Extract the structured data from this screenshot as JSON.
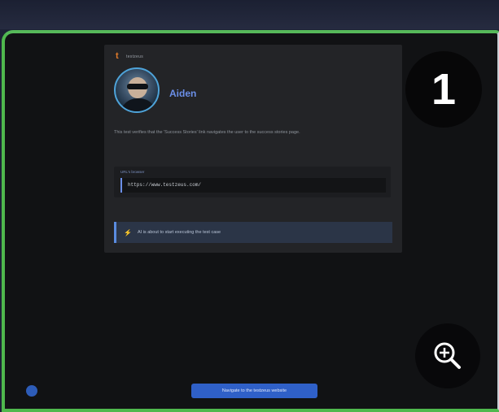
{
  "brand": {
    "logo_icon": "testzeus-logo-icon",
    "name": "testzeus",
    "logo_color": "#e07a2a"
  },
  "agent": {
    "name": "Aiden",
    "avatar_icon": "agent-avatar"
  },
  "test": {
    "description": "This test verifies that the 'Success Stories' link navigates the user to the success stories page.",
    "url_label": "URL's browser",
    "url_value": "https://www.testzeus.com/"
  },
  "status": {
    "icon": "lightning-bolt-icon",
    "text": "AI is about to start executing the test case"
  },
  "step": {
    "number": "1"
  },
  "zoom": {
    "icon": "zoom-in-icon"
  },
  "footer": {
    "navigate_label": "Navigate to the testzeus website",
    "indicator_icon": "info-dot-icon"
  },
  "colors": {
    "frame_border": "#4fb84d",
    "accent": "#6b8fe8",
    "button": "#2f60c8"
  }
}
